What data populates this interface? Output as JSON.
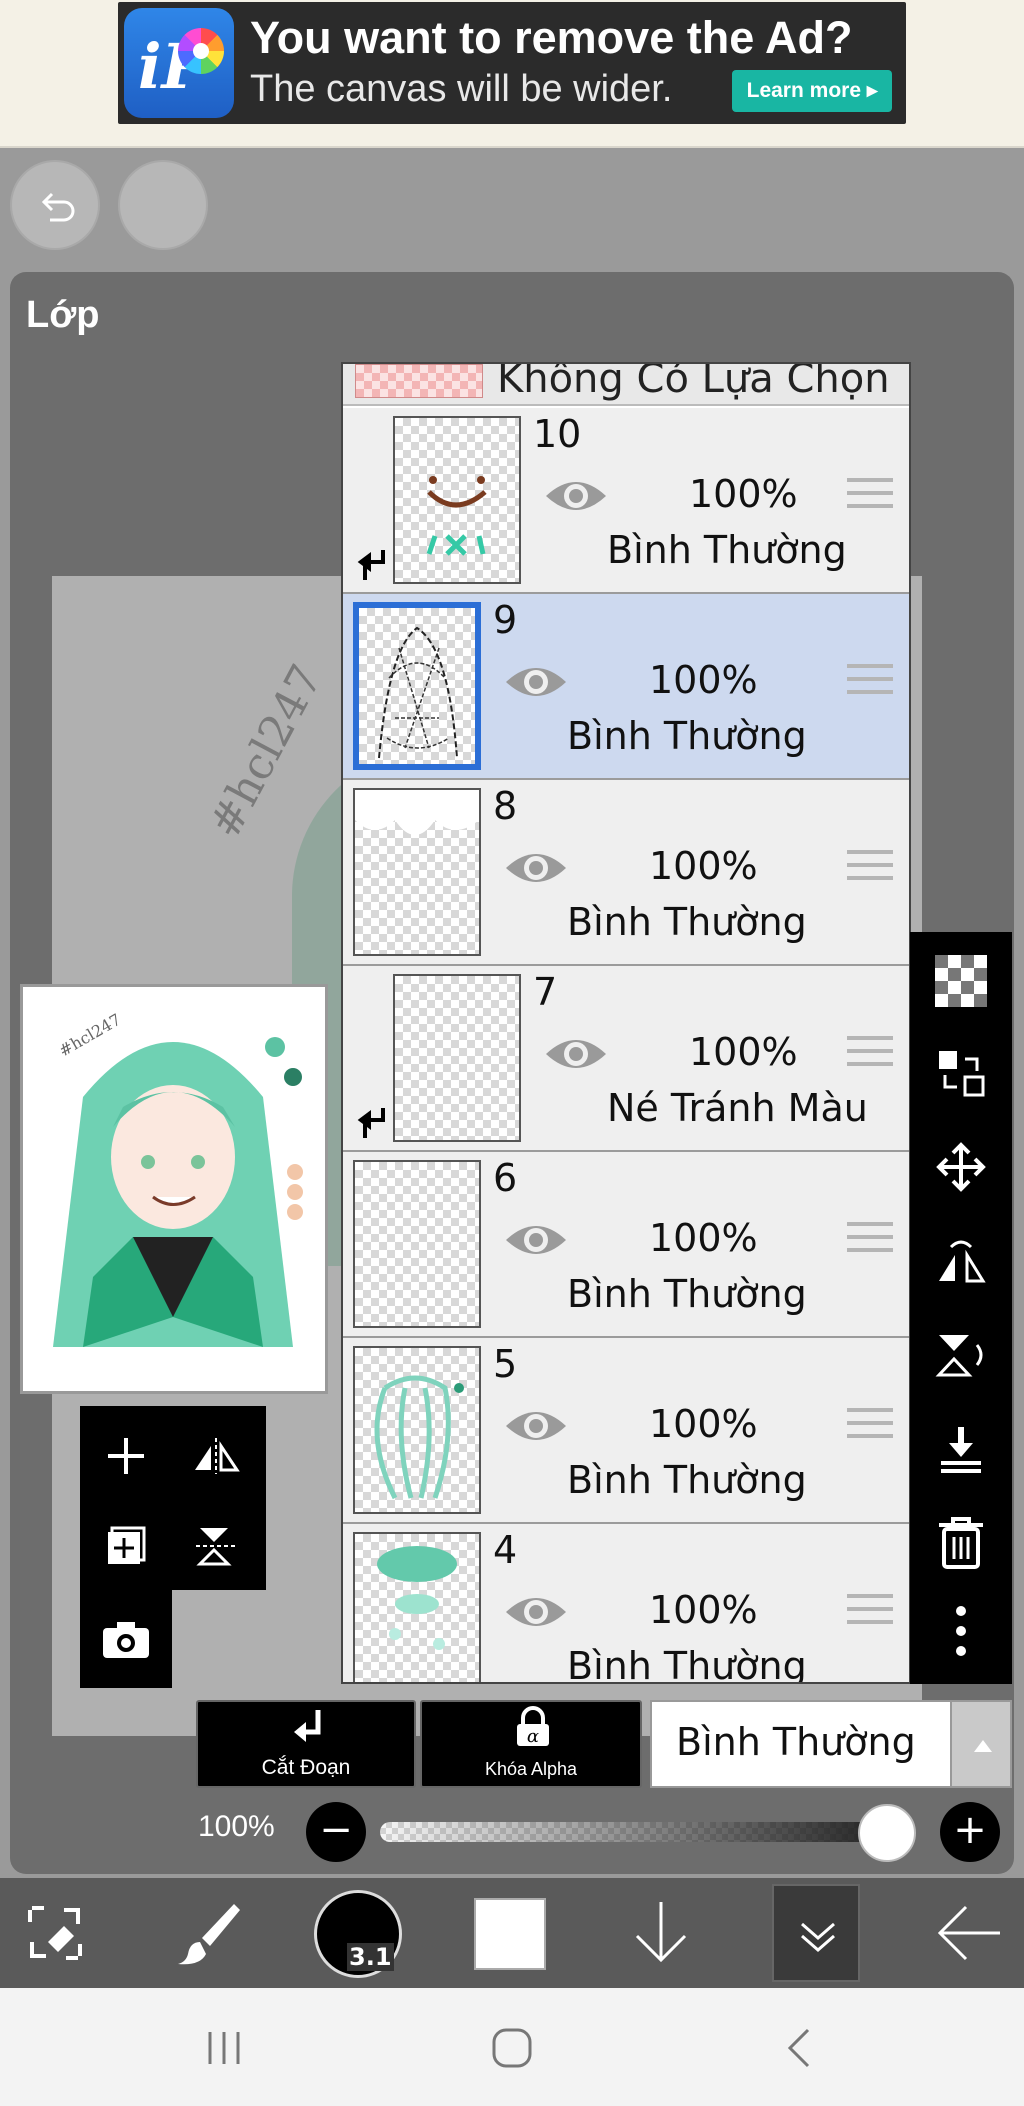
{
  "ad": {
    "title": "You want to remove the Ad?",
    "subtitle": "The canvas will be wider.",
    "cta": "Learn more ▸"
  },
  "panel": {
    "title": "Lớp"
  },
  "layers": {
    "no_selection_label": "Không Có Lựa Chọn",
    "items": [
      {
        "number": "10",
        "opacity": "100%",
        "blend": "Bình Thường",
        "clipped": true,
        "selected": false
      },
      {
        "number": "9",
        "opacity": "100%",
        "blend": "Bình Thường",
        "clipped": false,
        "selected": true
      },
      {
        "number": "8",
        "opacity": "100%",
        "blend": "Bình Thường",
        "clipped": false,
        "selected": false
      },
      {
        "number": "7",
        "opacity": "100%",
        "blend": "Né Tránh Màu",
        "clipped": true,
        "selected": false
      },
      {
        "number": "6",
        "opacity": "100%",
        "blend": "Bình Thường",
        "clipped": false,
        "selected": false
      },
      {
        "number": "5",
        "opacity": "100%",
        "blend": "Bình Thường",
        "clipped": false,
        "selected": false
      },
      {
        "number": "4",
        "opacity": "100%",
        "blend": "Bình Thường",
        "clipped": false,
        "selected": false
      }
    ]
  },
  "controls": {
    "clipping_label": "Cắt Đoạn",
    "alpha_lock_label": "Khóa Alpha",
    "blend_mode_value": "Bình Thường",
    "opacity_label": "100%",
    "opacity_value": 1.0,
    "minus": "−",
    "plus": "+"
  },
  "toolbar": {
    "brush_size": "3.1",
    "color": "#ffffff"
  },
  "colors": {
    "selection_blue": "#2b6ed6",
    "selected_row": "#cdd9ef",
    "ad_button": "#19b6a3"
  }
}
